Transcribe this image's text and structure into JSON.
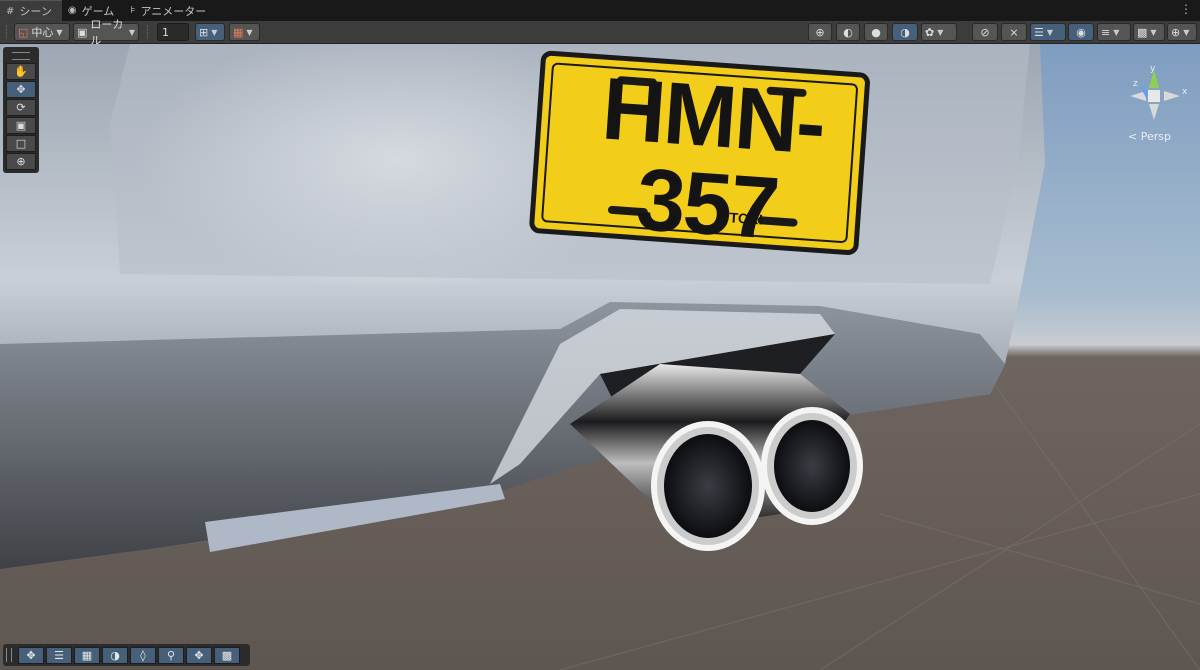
{
  "tabs": [
    {
      "label": "シーン",
      "icon": "grid-icon"
    },
    {
      "label": "ゲーム",
      "icon": "gamepad-icon"
    },
    {
      "label": "アニメーター",
      "icon": "animator-icon"
    }
  ],
  "toolbar": {
    "pivot_label": "中心",
    "space_label": "ローカル",
    "grid_size": "1"
  },
  "plate": {
    "text": "HMN-357",
    "brand": "ITTORI",
    "color": "#f2cd1a"
  },
  "gizmo": {
    "y_label": "y",
    "z_label": "z",
    "x_label": "x",
    "persp_label": "< Persp"
  },
  "tools": [
    "hand-tool",
    "move-tool",
    "rotate-tool",
    "scale-tool",
    "rect-tool",
    "transform-tool"
  ],
  "bottom_tools": [
    "move-icon",
    "align-icon",
    "snap-icon",
    "orbit-icon",
    "layers-icon",
    "search-icon",
    "pan-icon",
    "render-icon"
  ]
}
